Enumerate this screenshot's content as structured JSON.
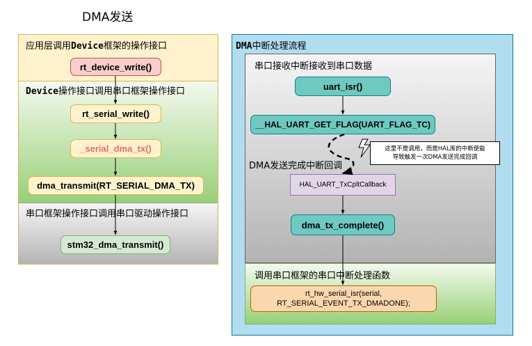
{
  "title": "DMA发送",
  "left_panel": {
    "lane1_label": [
      "应用层调用",
      "Device",
      "框架的操作接口"
    ],
    "lane2_label": [
      "Device",
      "操作接口调用串口框架操作接口"
    ],
    "lane3_label": "串口框架操作接口调用串口驱动操作接口",
    "nodes": {
      "rt_device_write": "rt_device_write()",
      "rt_serial_write": "rt_serial_write()",
      "serial_dma_tx": "_serial_dma_tx()",
      "dma_transmit": "dma_transmit(RT_SERIAL_DMA_TX)",
      "stm32_dma_transmit": "stm32_dma_transmit()"
    }
  },
  "right_panel": {
    "label": [
      "DMA",
      "中断处理流程"
    ],
    "section1_label": "串口接收中断接收到串口数据",
    "callback_label": "DMA发送完成中断回调",
    "section2_label": "调用串口框架的串口中断处理函数",
    "nodes": {
      "uart_isr": "uart_isr()",
      "hal_get_flag": "__HAL_UART_GET_FLAG(UART_FLAG_TC)",
      "tx_cplt_callback": "HAL_UART_TxCpltCallback",
      "dma_tx_complete": "dma_tx_complete()",
      "rt_hw_serial_isr_line1": "rt_hw_serial_isr(serial,",
      "rt_hw_serial_isr_line2": "RT_SERIAL_EVENT_TX_DMADONE);"
    },
    "note": [
      "这里不是调用，而是HAL库的中断使能",
      "导致触发一次DMA发送完成回调"
    ]
  },
  "colors": {
    "lane1_bg": "#fff2cc",
    "lane1_border": "#d6b656",
    "panel_bg": "#b1ddf0",
    "panel_border": "#10739e",
    "node_pink": "#f8cecc",
    "node_teal": "#6ec9c0",
    "node_purple": "#e1d5e7",
    "node_orange": "#fad7ac",
    "accent_red": "#ea6b66"
  }
}
